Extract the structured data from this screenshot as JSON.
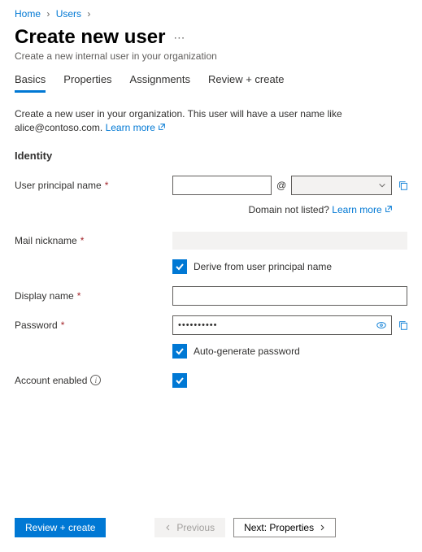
{
  "breadcrumb": {
    "home": "Home",
    "users": "Users"
  },
  "header": {
    "title": "Create new user",
    "subtitle": "Create a new internal user in your organization"
  },
  "tabs": {
    "basics": "Basics",
    "properties": "Properties",
    "assignments": "Assignments",
    "review": "Review + create"
  },
  "description": {
    "text_prefix": "Create a new user in your organization. This user will have a user name like alice@contoso.com. ",
    "learn_more": "Learn more"
  },
  "identity": {
    "heading": "Identity",
    "upn_label": "User principal name",
    "upn_value": "",
    "at": "@",
    "domain_value": "",
    "domain_hint": "Domain not listed? ",
    "domain_hint_link": "Learn more",
    "nickname_label": "Mail nickname",
    "derive_label": "Derive from user principal name",
    "display_label": "Display name",
    "display_value": "",
    "password_label": "Password",
    "password_value": "••••••••••",
    "autogen_label": "Auto-generate password",
    "account_enabled_label": "Account enabled"
  },
  "footer": {
    "review": "Review + create",
    "previous": "Previous",
    "next": "Next: Properties"
  }
}
